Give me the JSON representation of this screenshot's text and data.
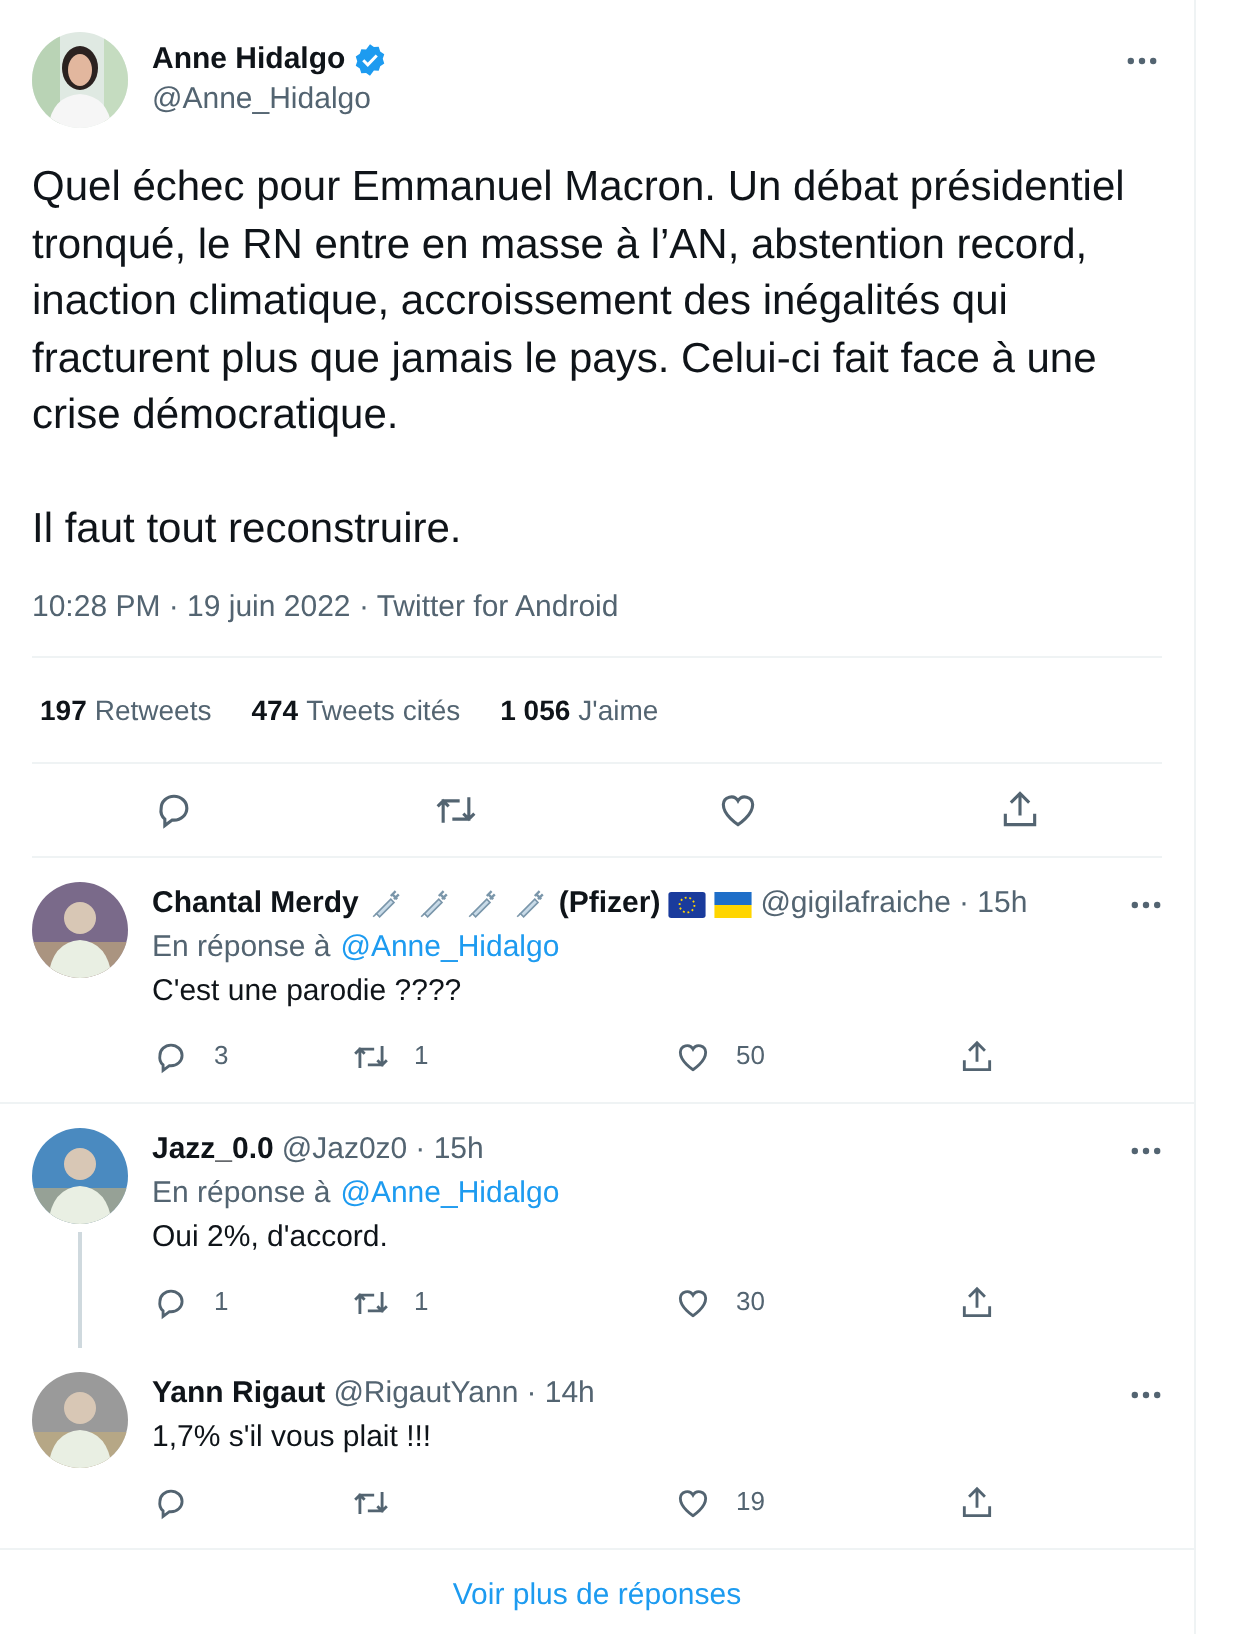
{
  "tweet": {
    "author": {
      "name": "Anne Hidalgo",
      "verified": true,
      "handle": "@Anne_Hidalgo"
    },
    "paragraphs": [
      "Quel échec pour Emmanuel Macron. Un débat présidentiel tronqué, le RN entre en masse à  l’AN, abstention record, inaction climatique, accroissement des inégalités qui fracturent plus que jamais le pays. Celui-ci fait face à une crise démocratique.",
      "Il faut tout reconstruire."
    ],
    "meta": "10:28 PM · 19 juin 2022 · Twitter for Android",
    "stats": [
      {
        "count": "197",
        "label": "Retweets"
      },
      {
        "count": "474",
        "label": "Tweets cités"
      },
      {
        "count": "1 056",
        "label": "J'aime"
      }
    ]
  },
  "replies": [
    {
      "name_parts": [
        {
          "kind": "text",
          "text": "Chantal Merdy"
        },
        {
          "kind": "syringe"
        },
        {
          "kind": "syringe"
        },
        {
          "kind": "syringe"
        },
        {
          "kind": "syringe"
        },
        {
          "kind": "text",
          "text": "(Pfizer)"
        },
        {
          "kind": "flag_eu"
        },
        {
          "kind": "flag_ua"
        }
      ],
      "handle": "@gigilafraiche",
      "time": "· 15h",
      "reply_to_label": "En réponse à",
      "reply_to": "@Anne_Hidalgo",
      "text": "C'est une parodie ????",
      "thread_line": false,
      "replies": "3",
      "retweets": "1",
      "likes": "50"
    },
    {
      "name_parts": [
        {
          "kind": "text",
          "text": "Jazz_0.0"
        }
      ],
      "handle": "@Jaz0z0",
      "time": "· 15h",
      "reply_to_label": "En réponse à",
      "reply_to": "@Anne_Hidalgo",
      "text": "Oui 2%, d'accord.",
      "thread_line": true,
      "replies": "1",
      "retweets": "1",
      "likes": "30"
    },
    {
      "name_parts": [
        {
          "kind": "text",
          "text": "Yann Rigaut"
        }
      ],
      "handle": "@RigautYann",
      "time": "· 14h",
      "text": "1,7% s'il vous plait !!!",
      "thread_line": false,
      "likes": "19"
    }
  ],
  "more_link": "Voir plus de réponses"
}
